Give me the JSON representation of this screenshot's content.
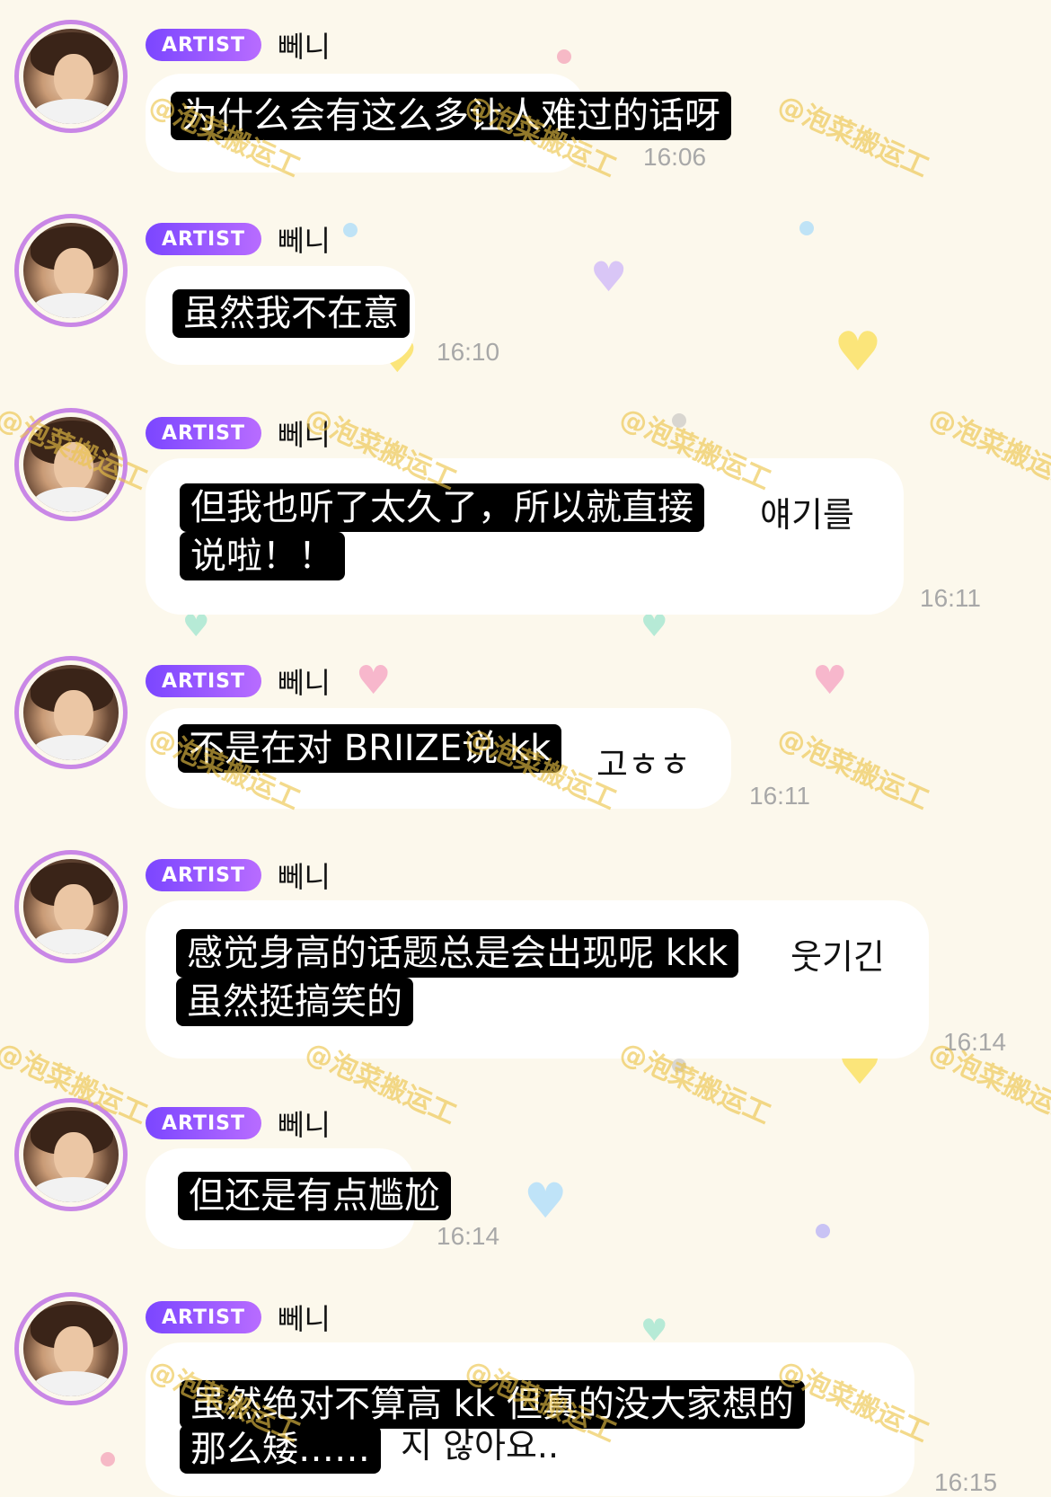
{
  "colors": {
    "background": "#fcf8ec",
    "badge_gradient_start": "#7b46ff",
    "badge_gradient_end": "#b86cff",
    "avatar_ring": "#c987e6",
    "subtitle_bg": "#000000",
    "timestamp": "#a8a8a8",
    "watermark": "#ecc446"
  },
  "watermark_text": "@泡菜搬运工",
  "messages": [
    {
      "badge": "ARTIST",
      "sender": "뻬니",
      "subtitle": [
        "为什么会有这么多让人难过的话呀"
      ],
      "original": [],
      "time": "16:06"
    },
    {
      "badge": "ARTIST",
      "sender": "뻬니",
      "subtitle": [
        "虽然我不在意"
      ],
      "original": [],
      "time": "16:10"
    },
    {
      "badge": "ARTIST",
      "sender": "뻬니",
      "subtitle": [
        "但我也听了太久了，所以就直接",
        "说啦！！"
      ],
      "original": [
        "얘기를"
      ],
      "time": "16:11"
    },
    {
      "badge": "ARTIST",
      "sender": "뻬니",
      "subtitle": [
        "不是在对 BRIIZE说 kk"
      ],
      "original": [
        "고ㅎㅎ"
      ],
      "time": "16:11"
    },
    {
      "badge": "ARTIST",
      "sender": "뻬니",
      "subtitle": [
        "感觉身高的话题总是会出现呢 kkk",
        "虽然挺搞笑的"
      ],
      "original": [
        "웃기긴"
      ],
      "time": "16:14"
    },
    {
      "badge": "ARTIST",
      "sender": "뻬니",
      "subtitle": [
        "但还是有点尴尬"
      ],
      "original": [],
      "time": "16:14"
    },
    {
      "badge": "ARTIST",
      "sender": "뻬니",
      "subtitle": [
        "虽然绝对不算高 kk 但真的没大家想的",
        "那么矮……"
      ],
      "original": [
        "지 않아요.."
      ],
      "time": "16:15"
    }
  ]
}
